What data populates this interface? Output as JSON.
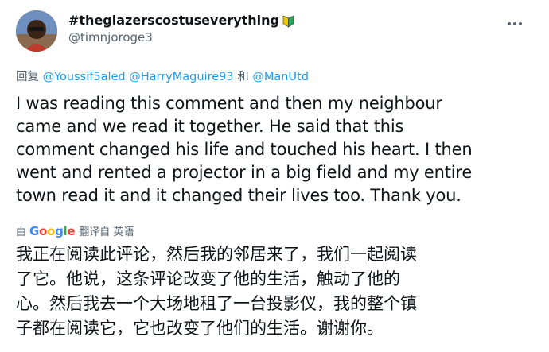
{
  "author": {
    "display_name": "#theglazerscostuseverything",
    "handle": "@timnjoroge3",
    "badge_icon": "beginner-leaf-icon"
  },
  "reply_context": {
    "prefix": "回复",
    "mentions": [
      "@Youssif5aled",
      "@HarryMaguire93",
      "@ManUtd"
    ],
    "conjunction": "和"
  },
  "tweet": {
    "lines": [
      "I was reading this comment and then my neighbour",
      "came and we read it together. He said that this",
      "comment changed his life and touched his heart. I then",
      "went and rented a projector in a big field and my entire",
      "town read it and it changed their lives too. Thank you."
    ]
  },
  "translation": {
    "prefix": "由",
    "provider": "Google",
    "suffix": "翻译自 英语",
    "lines": [
      "我正在阅读此评论，然后我的邻居来了，我们一起阅读",
      "了它。他说，这条评论改变了他的生活，触动了他的",
      "心。然后我去一个大场地租了一台投影仪，我的整个镇",
      "子都在阅读它，它也改变了他们的生活。谢谢你。"
    ]
  },
  "colors": {
    "link": "#1d9bf0",
    "secondary_text": "#536471",
    "primary_text": "#0f1419"
  }
}
